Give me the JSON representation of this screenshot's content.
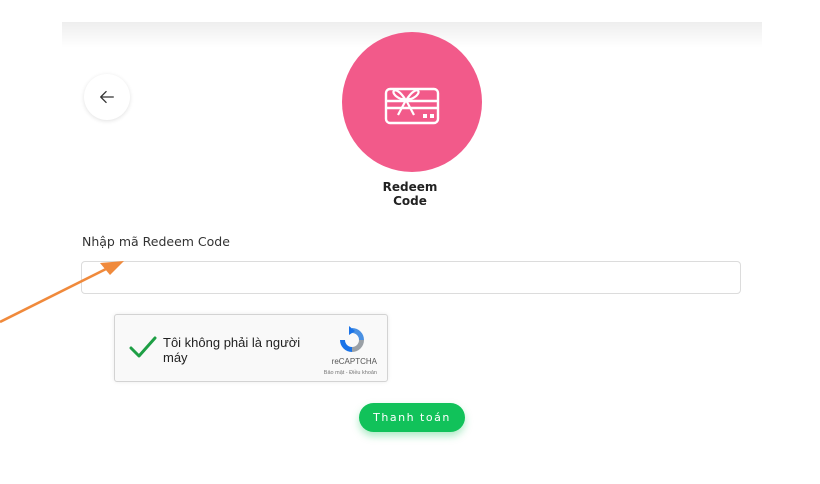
{
  "header": {
    "back_icon": "arrow-left-icon",
    "feature_icon": "gift-card-icon",
    "title_line1": "Redeem",
    "title_line2": "Code",
    "accent_color": "#f25a8a"
  },
  "form": {
    "code_label": "Nhập mã Redeem Code",
    "code_value": "",
    "code_placeholder": ""
  },
  "captcha": {
    "check_icon": "checkmark-icon",
    "checked": true,
    "text": "Tôi không phải là người máy",
    "brand": "reCAPTCHA",
    "links": "Bảo mật - Điều khoản"
  },
  "actions": {
    "pay_label": "Thanh toán",
    "pay_color": "#11c25a"
  },
  "annotation": {
    "pointer_icon": "orange-arrow-icon",
    "color": "#f08a3c"
  }
}
